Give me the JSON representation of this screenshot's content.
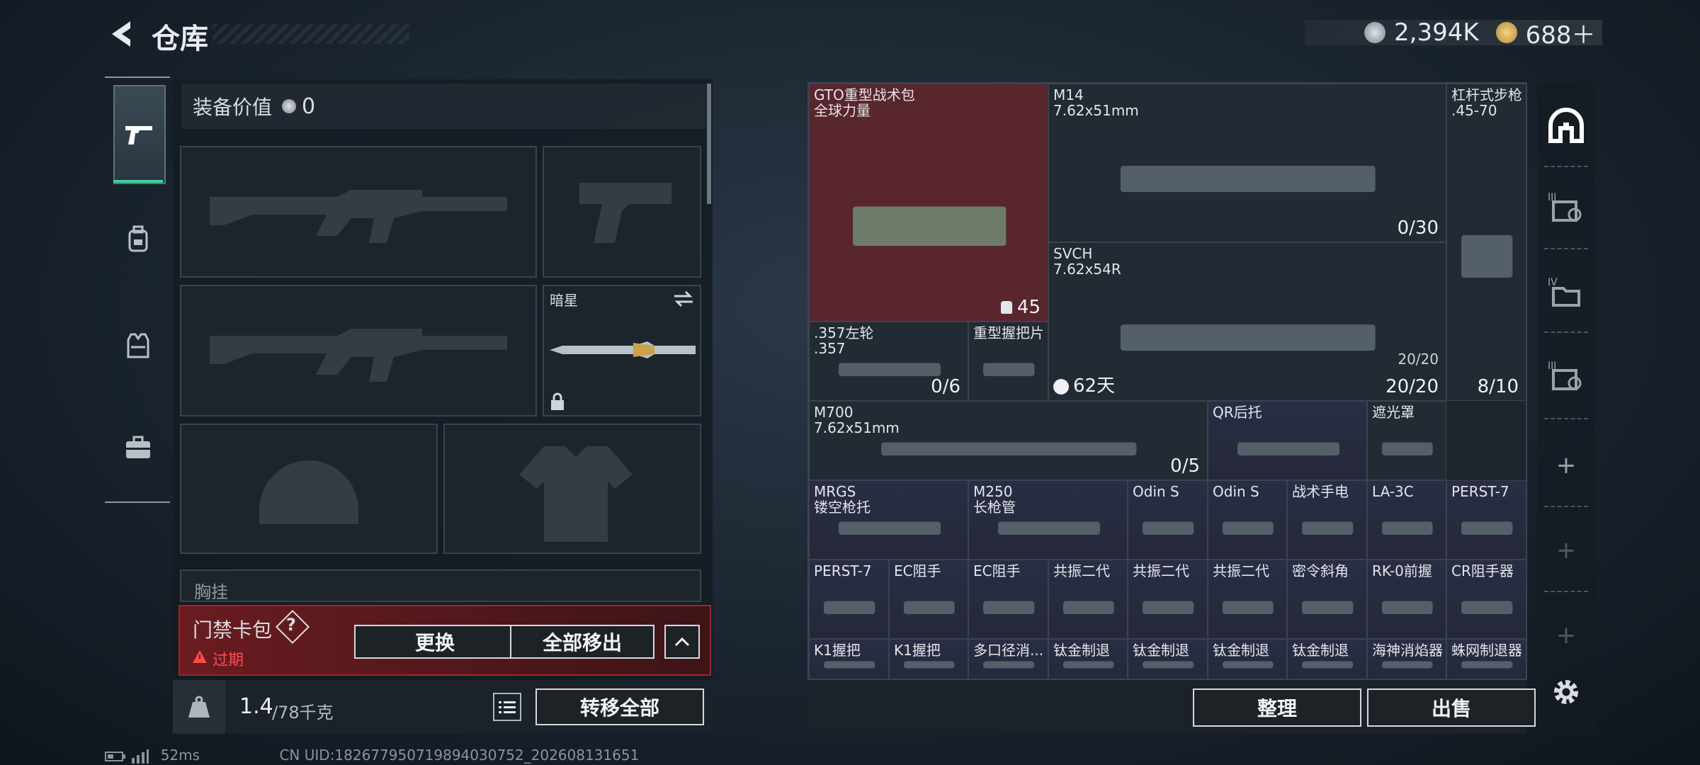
{
  "header": {
    "title": "仓库"
  },
  "currency": {
    "silver": "2,394K",
    "gold": "688＋"
  },
  "equipment": {
    "value_label": "装备价值",
    "value": "0",
    "knife_name": "暗星",
    "chest_label": "胸挂"
  },
  "bag": {
    "name": "门禁卡包",
    "help": "?",
    "status": "过期",
    "replace_btn": "更换",
    "move_all_btn": "全部移出"
  },
  "weight": {
    "current": "1.4",
    "max": "/78千克",
    "transfer_all_btn": "转移全部"
  },
  "grid_items": [
    {
      "name": "GTO重型战术包\n全球力量",
      "count": "45"
    },
    {
      "name": "M14\n7.62x51mm",
      "count": "0/30"
    },
    {
      "name": "杠杆式步枪\n.45-70",
      "count": "8/10"
    },
    {
      "name": "SVCH\n7.62x54R",
      "count": "20/20",
      "ammo_small": "20/20",
      "timer": "62天"
    },
    {
      "name": ".357左轮\n.357",
      "count": "0/6"
    },
    {
      "name": "重型握把片",
      "count": ""
    },
    {
      "name": "M700\n7.62x51mm",
      "count": "0/5"
    },
    {
      "name": "QR后托",
      "count": ""
    },
    {
      "name": "遮光罩",
      "count": ""
    },
    {
      "name": "MRGS\n镂空枪托",
      "count": ""
    },
    {
      "name": "M250\n长枪管",
      "count": ""
    },
    {
      "name": "Odin S",
      "count": ""
    },
    {
      "name": "Odin S",
      "count": ""
    },
    {
      "name": "战术手电",
      "count": ""
    },
    {
      "name": "LA-3C",
      "count": ""
    },
    {
      "name": "PERST-7",
      "count": ""
    },
    {
      "name": "PERST-7",
      "count": ""
    },
    {
      "name": "EC阻手",
      "count": ""
    },
    {
      "name": "EC阻手",
      "count": ""
    },
    {
      "name": "共振二代",
      "count": ""
    },
    {
      "name": "共振二代",
      "count": ""
    },
    {
      "name": "共振二代",
      "count": ""
    },
    {
      "name": "密令斜角",
      "count": ""
    },
    {
      "name": "RK-0前握",
      "count": ""
    },
    {
      "name": "CR阻手器",
      "count": ""
    },
    {
      "name": "K1握把",
      "count": ""
    },
    {
      "name": "K1握把",
      "count": ""
    },
    {
      "name": "多口径消...",
      "count": ""
    },
    {
      "name": "钛金制退",
      "count": ""
    },
    {
      "name": "钛金制退",
      "count": ""
    },
    {
      "name": "钛金制退",
      "count": ""
    },
    {
      "name": "钛金制退",
      "count": ""
    },
    {
      "name": "海神消焰器",
      "count": ""
    },
    {
      "name": "蛛网制退器",
      "count": ""
    }
  ],
  "actions": {
    "sort": "整理",
    "sell": "出售"
  },
  "status": {
    "ping": "52ms",
    "uid": "CN UID:182677950719894030752_202608131651"
  },
  "colors": {
    "accent_green": "#3bd29b",
    "danger_red": "#a0262b",
    "expired_red": "#ff4a4a",
    "highlight_red": "#5a262d"
  }
}
